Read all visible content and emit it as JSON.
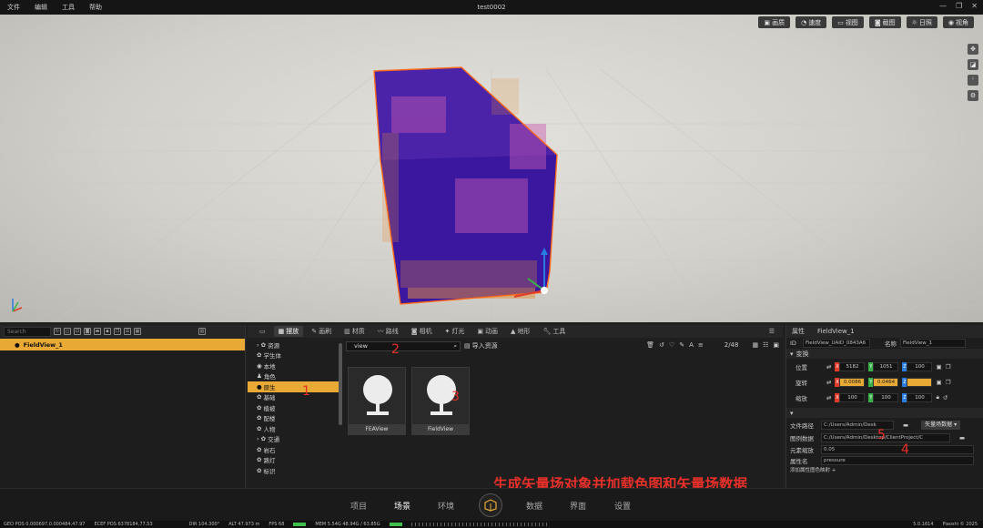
{
  "menu": [
    "文件",
    "编辑",
    "工具",
    "帮助"
  ],
  "window_title": "test0002",
  "viewport_toolbar": [
    {
      "label": "画质",
      "icon": "image-icon"
    },
    {
      "label": "速度",
      "icon": "gauge-icon"
    },
    {
      "label": "视图",
      "icon": "view-icon"
    },
    {
      "label": "截图",
      "icon": "camera-icon"
    },
    {
      "label": "日照",
      "icon": "sun-icon"
    },
    {
      "label": "视角",
      "icon": "eye-icon"
    }
  ],
  "outliner": {
    "search_placeholder": "Search",
    "selected_item": "FieldView_1"
  },
  "asset_tabs": [
    "摆放",
    "画刷",
    "材质",
    "路线",
    "相机",
    "灯光",
    "动画",
    "地形",
    "工具"
  ],
  "asset_tree": [
    "资源",
    "学生体",
    "本地",
    "角色",
    "原生",
    "基础",
    "植被",
    "配楼",
    "人物",
    "交通",
    "岩石",
    "路灯",
    "标识"
  ],
  "asset_tree_selected": "原生",
  "content": {
    "filter_value": "view",
    "import_label": "导入资源",
    "count": "2/48",
    "tiles": [
      "FEAView",
      "FieldView"
    ]
  },
  "annotations": {
    "caption": "生成矢量场对象并加载色图和矢量场数据",
    "numbers": [
      "1",
      "2",
      "3",
      "4",
      "5"
    ]
  },
  "properties": {
    "title": "属性",
    "object_name": "FieldView_1",
    "id_label": "ID",
    "id_value": "FieldView_UAID_0843A6",
    "name_label": "名称",
    "name_value": "FieldView_1",
    "transform_label": "变换",
    "position_label": "位置",
    "position": [
      "5182",
      "1051",
      "100"
    ],
    "rotation_label": "旋转",
    "rotation": [
      "0.0086",
      "0.0464",
      ""
    ],
    "scale_label": "缩放",
    "scale": [
      "100",
      "100",
      "100"
    ],
    "file_path_label": "文件路径",
    "file_path_value": "C:/Users/Admin/Desk",
    "file_type": "矢量场数据",
    "colormap_label": "图例数据",
    "colormap_value": "C:/Users/Admin/Desktop/ClientProject/C",
    "element_scale_label": "元素缩放",
    "element_scale_value": "0.05",
    "attr_name_label": "属性名",
    "attr_name_value": "pressure",
    "add_map_label": "添加属性图色映射 +"
  },
  "bottom_nav": [
    "项目",
    "场景",
    "环境",
    "数据",
    "界面",
    "设置"
  ],
  "bottom_nav_active": "场景",
  "status": {
    "geo_pos": "GEO POS 0.000697,0.000484,47.97",
    "ecef_pos": "ECEF POS 6378184,77,53",
    "dir": "DIR 104.300°",
    "alt": "ALT 47.973 m",
    "fps": "FPS 68",
    "mem": "MEM 5.54G 48.94G / 63.85G",
    "version": "5.0.1614",
    "brand": "Piaoshi © 2025"
  },
  "colors": {
    "accent": "#e8a935",
    "annotation": "#e8302a",
    "field_cube": "#4a1fa0",
    "selection_outline": "#ff6a1a"
  }
}
